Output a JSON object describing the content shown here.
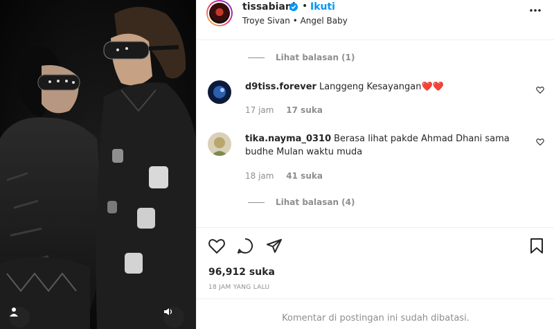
{
  "post": {
    "username": "tissabiani",
    "follow_label": "Ikuti",
    "separator": "•",
    "music": "Troye Sivan • Angel Baby",
    "icons": {
      "more": "more-horizontal-icon",
      "verified": "verified-badge-icon",
      "tag": "user-tag-icon",
      "sound": "sound-icon"
    }
  },
  "comments": {
    "view_replies_top": "Lihat balasan (1)",
    "items": [
      {
        "user": "d9tiss.forever",
        "text": "Langgeng Kesayangan❤️❤️",
        "time": "17 jam",
        "likes": "17 suka"
      },
      {
        "user": "tika.nayma_0310",
        "text": "Berasa lihat pakde Ahmad Dhani sama budhe Mulan waktu muda",
        "time": "18 jam",
        "likes": "41 suka"
      }
    ],
    "view_replies_bottom": "Lihat balasan (4)"
  },
  "actions": {
    "likes": "96,912 suka",
    "time_ago": "18 JAM YANG LALU",
    "icons": [
      "heart-icon",
      "comment-icon",
      "share-icon",
      "bookmark-icon"
    ]
  },
  "footer": {
    "restricted": "Komentar di postingan ini sudah dibatasi."
  },
  "colors": {
    "link": "#0095f6",
    "text": "#262626",
    "muted": "#8e8e8e",
    "heart": "#ed4956"
  }
}
